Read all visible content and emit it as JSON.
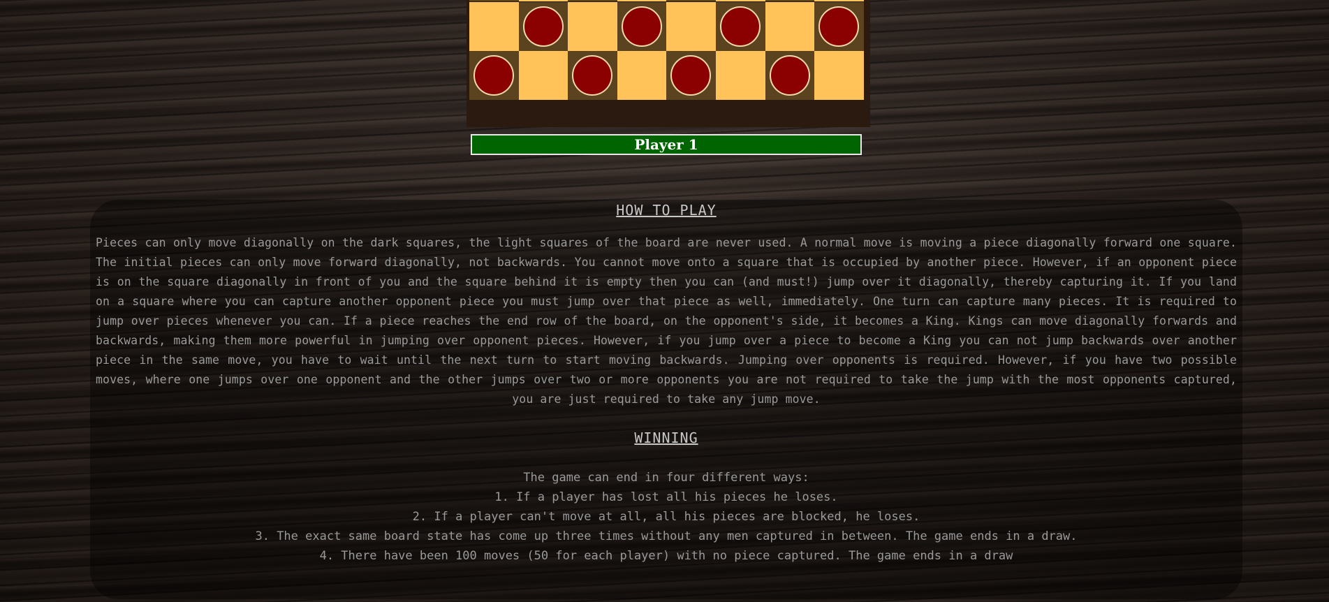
{
  "board": {
    "colors": {
      "light": "#ffc35a",
      "dark": "#5b4320",
      "piece": "#8b0000",
      "frame": "#2b1a0f"
    },
    "visible_rows": [
      {
        "pieces_on": "dark",
        "piece_style": "top"
      },
      {
        "pieces_on": "dark",
        "piece_style": "red"
      },
      {
        "pieces_on": "dark",
        "piece_style": "red"
      }
    ]
  },
  "player_bar": {
    "label": "Player 1",
    "color": "#006400"
  },
  "how_to_play": {
    "title": "HOW TO PLAY",
    "text": "Pieces can only move diagonally on the dark squares, the light squares of the board are never used. A normal move is moving a piece diagonally forward one square. The initial pieces can only move forward diagonally, not backwards. You cannot move onto a square that is occupied by another piece. However, if an opponent piece is on the square diagonally in front of you and the square behind it is empty then you can (and must!) jump over it diagonally, thereby capturing it. If you land on a square where you can capture another opponent piece you must jump over that piece as well, immediately. One turn can capture many pieces. It is required to jump over pieces whenever you can. If a piece reaches the end row of the board, on the opponent's side, it becomes a King. Kings can move diagonally forwards and backwards, making them more powerful in jumping over opponent pieces. However, if you jump over a piece to become a King you can not jump backwards over another piece in the same move, you have to wait until the next turn to start moving backwards. Jumping over opponents is required. However, if you have two possible moves, where one jumps over one opponent and the other jumps over two or more opponents you are not required to take the jump with the most opponents captured, you are just required to take any jump move."
  },
  "winning": {
    "title": "WINNING",
    "intro": "The game can end in four different ways:",
    "items": [
      "1. If a player has lost all his pieces he loses.",
      "2. If a player can't move at all, all his pieces are blocked, he loses.",
      "3. The exact same board state has come up three times without any men captured in between. The game ends in a draw.",
      "4. There have been 100 moves (50 for each player) with no piece captured. The game ends in a draw"
    ]
  }
}
